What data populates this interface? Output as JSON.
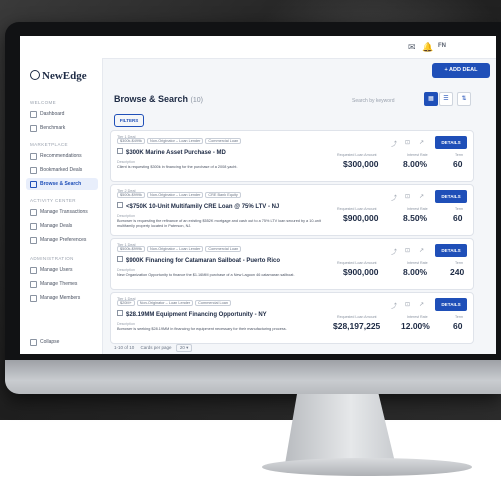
{
  "topbar": {
    "icon_a": "✉",
    "icon_b": "🔔",
    "user": "FN"
  },
  "sidebar": {
    "logo": "NewEdge",
    "sections": [
      {
        "title": "WELCOME",
        "items": [
          {
            "label": "Dashboard"
          },
          {
            "label": "Benchmark"
          }
        ]
      },
      {
        "title": "MARKETPLACE",
        "items": [
          {
            "label": "Recommendations"
          },
          {
            "label": "Bookmarked Deals"
          },
          {
            "label": "Browse & Search"
          }
        ]
      },
      {
        "title": "ACTIVITY CENTER",
        "items": [
          {
            "label": "Manage Transactions"
          },
          {
            "label": "Manage Deals"
          },
          {
            "label": "Manage Preferences"
          }
        ]
      },
      {
        "title": "ADMINISTRATION",
        "items": [
          {
            "label": "Manage Users"
          },
          {
            "label": "Manage Themes"
          },
          {
            "label": "Manage Members"
          }
        ]
      }
    ],
    "collapse": "Collapse"
  },
  "main": {
    "add_button": "+ ADD DEAL",
    "title": "Browse & Search",
    "count": "(10)",
    "search_hint": "Search by keyword",
    "filters": "FILTERS",
    "pager": {
      "range": "1-10 of 10",
      "per_page_label": "Cards per page",
      "per_page": "20"
    }
  },
  "deals": [
    {
      "tag_top": "Tier 1 Deal",
      "tags": [
        "$300k-$499k",
        "Non-Originator – Loan Lender",
        "Commercial Loan"
      ],
      "title": "$300K Marine Asset Purchase - MD",
      "desc_label": "Description",
      "desc": "Client is requesting $300k in financing for the purchase of a 2008 yacht.",
      "amount_label": "Requested Loan Amount",
      "amount": "$300,000",
      "rate_label": "Interest Rate",
      "rate": "8.00%",
      "term_label": "Term",
      "term": "60",
      "details": "DETAILS"
    },
    {
      "tag_top": "Tier 2 Deal",
      "tags": [
        "$500k-$999k",
        "Non-Originator – Loan Lender",
        "CRE Bank Equity"
      ],
      "title": "<$750K 10-Unit Multifamily CRE Loan @ 75% LTV - NJ",
      "desc_label": "Description",
      "desc": "Borrower is requesting the refinance of an existing $552K mortgage and cash out to a 75% LTV loan secured by a 10-unit multifamily property located in Paterson, NJ.",
      "amount_label": "Requested Loan Amount",
      "amount": "$900,000",
      "rate_label": "Interest Rate",
      "rate": "8.50%",
      "term_label": "Term",
      "term": "60",
      "details": "DETAILS"
    },
    {
      "tag_top": "Tier 1 Deal",
      "tags": [
        "$500k-$999k",
        "Non-Originator – Loan Lender",
        "Commercial Loan"
      ],
      "title": "$900K Financing for Catamaran Sailboat - Puerto Rico",
      "desc_label": "Description",
      "desc": "New Organization Opportunity to finance the $1.16MM purchase of a New Lagoon 46 catamaran sailboat.",
      "amount_label": "Requested Loan Amount",
      "amount": "$900,000",
      "rate_label": "Interest Rate",
      "rate": "8.00%",
      "term_label": "Term",
      "term": "240",
      "details": "DETAILS"
    },
    {
      "tag_top": "Tier 1 Deal",
      "tags": [
        "$20M+",
        "Non-Originator – Loan Lender",
        "Commercial Loan"
      ],
      "title": "$28.19MM Equipment Financing Opportunity - NY",
      "desc_label": "Description",
      "desc": "Borrower is seeking $28.19MM in financing for equipment necessary for their manufacturing process.",
      "amount_label": "Requested Loan Amount",
      "amount": "$28,197,225",
      "rate_label": "Interest Rate",
      "rate": "12.00%",
      "term_label": "Term",
      "term": "60",
      "details": "DETAILS"
    }
  ]
}
